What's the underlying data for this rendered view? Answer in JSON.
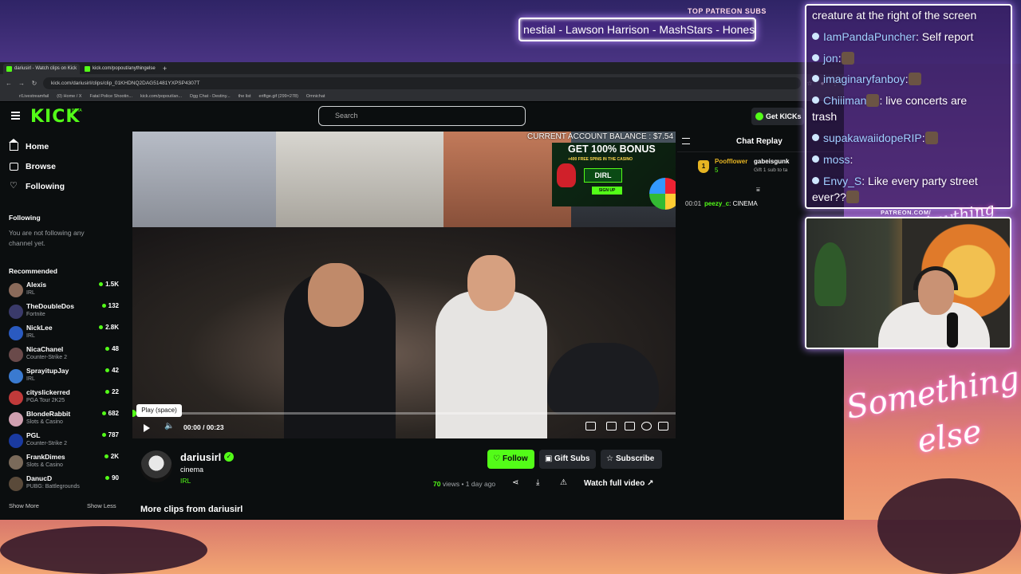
{
  "overlay": {
    "ticker_title": "TOP PATREON SUBS",
    "ticker_text": "nestial - Lawson Harrison - MashStars - Honest",
    "patreon_tag": "PATREON.COM/",
    "anything_else": "Anything else",
    "something": "Something",
    "else": "else"
  },
  "stream_chat": [
    {
      "user": "",
      "text": "creature at the right of the screen"
    },
    {
      "user": "IamPandaPuncher",
      "text": ": Self report"
    },
    {
      "user": "jon",
      "text": ":"
    },
    {
      "user": "imaginaryfanboy",
      "text": ":"
    },
    {
      "user": "Chiiiman",
      "text": ": live concerts are"
    },
    {
      "user": "",
      "text": "trash"
    },
    {
      "user": "supakawaiidopeRIP",
      "text": ":"
    },
    {
      "user": "moss",
      "text": ":"
    },
    {
      "user": "Envy_S",
      "text": ": Like every party street"
    },
    {
      "user": "",
      "text": "ever??"
    }
  ],
  "browser": {
    "tabs": [
      {
        "label": "dariusirl - Watch clips on Kick",
        "active": true
      },
      {
        "label": "kick.com/popout/anythingelse",
        "active": false
      }
    ],
    "new_tab": "+",
    "url": "kick.com/dariusirl/clips/clip_01KHDNQ2DAG51481YXPSP4307T",
    "bookmarks": [
      "r/Livestreamfail",
      "(0) Home / X",
      "Fatal Police Shootin...",
      "kick.com/popout/an...",
      "Dgg Chat - Destiny...",
      "the list",
      "eriftge.gif (299×278)",
      "Omnichat"
    ]
  },
  "kick": {
    "logo": "KICK",
    "logo_beta": "BETA",
    "search_placeholder": "Search",
    "get_kicks": "Get KICKs"
  },
  "sidebar": {
    "nav": [
      {
        "label": "Home",
        "icon": "home-icon"
      },
      {
        "label": "Browse",
        "icon": "browse-icon"
      },
      {
        "label": "Following",
        "icon": "heart-icon"
      }
    ],
    "following_heading": "Following",
    "following_note": "You are not following any channel yet.",
    "recommended_heading": "Recommended",
    "recommended": [
      {
        "name": "Alexis",
        "category": "IRL",
        "viewers": "1.5K",
        "color": "#8a6a5a"
      },
      {
        "name": "TheDoubleDos",
        "category": "Fortnite",
        "viewers": "132",
        "color": "#3a3a6a"
      },
      {
        "name": "NickLee",
        "category": "IRL",
        "viewers": "2.8K",
        "color": "#2a5ac0"
      },
      {
        "name": "NicaChanel",
        "category": "Counter-Strike 2",
        "viewers": "48",
        "color": "#6a4a4a"
      },
      {
        "name": "SprayitupJay",
        "category": "IRL",
        "viewers": "42",
        "color": "#3a7ad0"
      },
      {
        "name": "cityslickerred",
        "category": "PGA Tour 2K25",
        "viewers": "22",
        "color": "#c03a3a"
      },
      {
        "name": "BlondeRabbit",
        "category": "Slots & Casino",
        "viewers": "682",
        "color": "#d0a0b0"
      },
      {
        "name": "PGL",
        "category": "Counter-Strike 2",
        "viewers": "787",
        "color": "#1a3aa0"
      },
      {
        "name": "FrankDimes",
        "category": "Slots & Casino",
        "viewers": "2K",
        "color": "#7a6a5a"
      },
      {
        "name": "DanucD",
        "category": "PUBG: Battlegrounds",
        "viewers": "90",
        "color": "#5a4a3a"
      }
    ],
    "show_more": "Show More",
    "show_less": "Show Less"
  },
  "video": {
    "balance": "CURRENT ACCOUNT BALANCE : $7.54",
    "promo_title": "GET 100% BONUS",
    "promo_sub": "+400 FREE SPINS IN THE CASINO",
    "promo_code": "DIRL",
    "promo_signup": "SIGN UP",
    "tooltip": "Play (space)",
    "time": "00:00 / 00:23",
    "progress": 0
  },
  "channel": {
    "name": "dariusirl",
    "clip_title": "cinema",
    "category": "IRL",
    "follow": "Follow",
    "gift_subs": "Gift Subs",
    "subscribe": "Subscribe",
    "views_count": "70",
    "views_label": " views",
    "age": "• 1 day ago",
    "watch_full": "Watch full video",
    "more_clips": "More clips from dariusirl"
  },
  "chat": {
    "title": "Chat Replay",
    "pinned_user": "Poofflower",
    "pinned_rank": "1",
    "pinned_count": "5",
    "gifter": "gabeisgunk",
    "gift_line": "Gift 1 sub to ta",
    "message": {
      "time": "00:01",
      "user": "peezy_c",
      "text": ": CINEMA"
    }
  },
  "colors": {
    "kick_green": "#53fc18",
    "background": "#0b0e0f",
    "panel": "#24272c"
  }
}
